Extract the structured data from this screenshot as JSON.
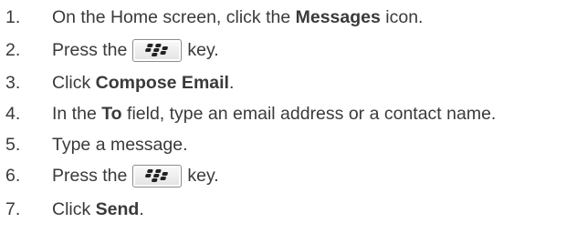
{
  "steps": [
    {
      "num": "1.",
      "before": "On the Home screen, click the ",
      "bold": "Messages",
      "after": " icon."
    },
    {
      "num": "2.",
      "before": "Press the",
      "after": "key.",
      "key_icon": "blackberry-menu-key-icon"
    },
    {
      "num": "3.",
      "before": "Click ",
      "bold": "Compose Email",
      "after": "."
    },
    {
      "num": "4.",
      "before": "In the ",
      "bold": "To",
      "after": " field, type an email address or a contact name."
    },
    {
      "num": "5.",
      "before": "Type a message."
    },
    {
      "num": "6.",
      "before": "Press the",
      "after": "key.",
      "key_icon": "blackberry-menu-key-icon"
    },
    {
      "num": "7.",
      "before": "Click ",
      "bold": "Send",
      "after": "."
    }
  ],
  "colors": {
    "text": "#3a3a3a",
    "key_border": "#8c8c8c"
  }
}
